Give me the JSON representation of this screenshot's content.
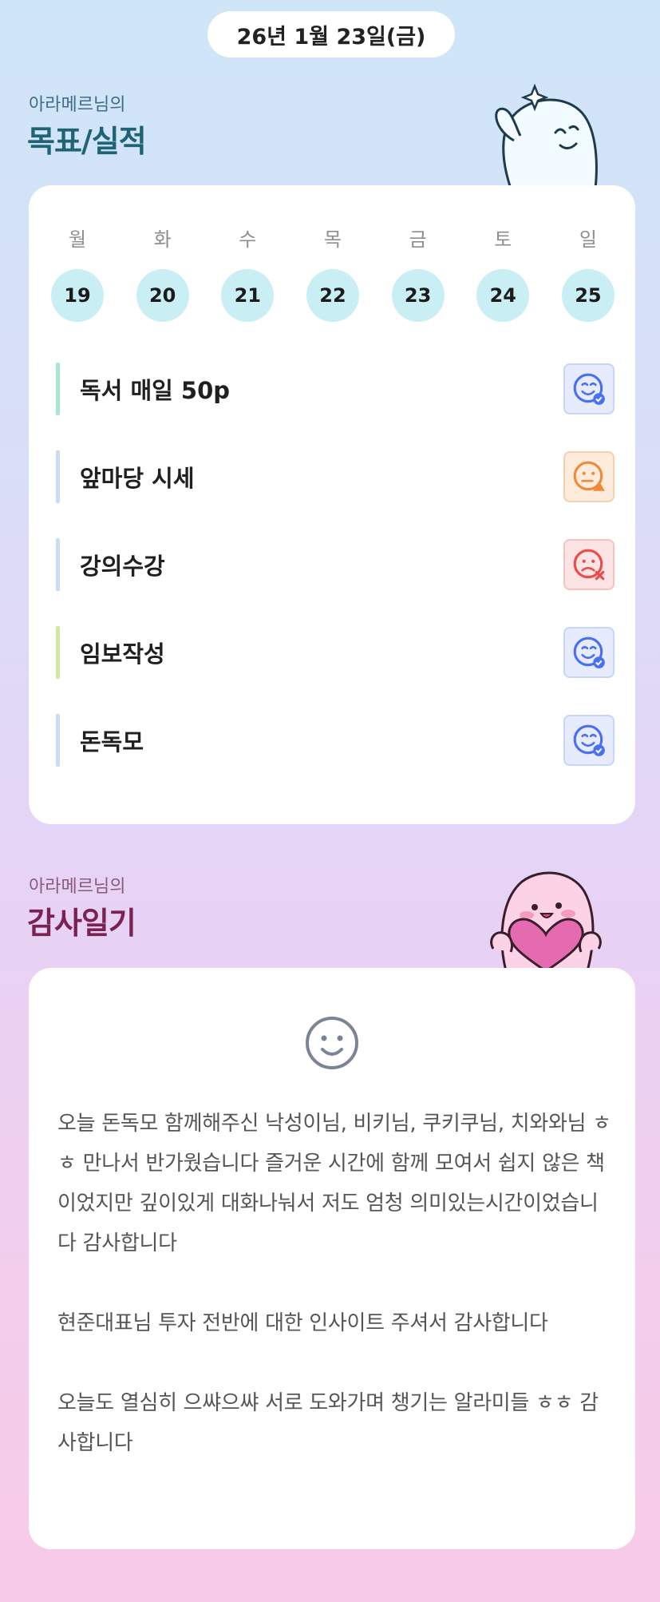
{
  "header": {
    "date": "26년 1월 23일(금)"
  },
  "goals_section": {
    "subtitle": "아라메르님의",
    "title": "목표/실적",
    "weekdays": [
      "월",
      "화",
      "수",
      "목",
      "금",
      "토",
      "일"
    ],
    "dates": [
      "19",
      "20",
      "21",
      "22",
      "23",
      "24",
      "25"
    ],
    "items": [
      {
        "label": "독서 매일 50p",
        "status": "done",
        "bar_color": "#a9e7d5"
      },
      {
        "label": "앞마당 시세",
        "status": "partial",
        "bar_color": "#c9dcf3"
      },
      {
        "label": "강의수강",
        "status": "failed",
        "bar_color": "#c9dcf3"
      },
      {
        "label": "임보작성",
        "status": "done",
        "bar_color": "#cdeaa0"
      },
      {
        "label": "돈독모",
        "status": "done",
        "bar_color": "#c9dcf3"
      }
    ]
  },
  "gratitude_section": {
    "subtitle": "아라메르님의",
    "title": "감사일기",
    "paragraphs": [
      "오늘 돈독모 함께해주신 낙성이님, 비키님, 쿠키쿠님, 치와와님 ㅎㅎ 만나서 반가웠습니다 즐거운 시간에 함께 모여서 쉽지 않은 책이었지만 깊이있게 대화나눠서 저도 엄청 의미있는시간이었습니다 감사합니다",
      "현준대표님 투자 전반에 대한 인사이트 주셔서 감사합니다",
      "오늘도 열심히 으쌰으쌰 서로 도와가며 챙기는 알라미들 ㅎㅎ 감사합니다"
    ]
  },
  "status_colors": {
    "done": {
      "bg": "#e6ecfd",
      "stroke": "#4a6ff2",
      "border": "#c7d4fb"
    },
    "partial": {
      "bg": "#fdebdc",
      "stroke": "#f08a3a",
      "border": "#f8cfac"
    },
    "failed": {
      "bg": "#fde4e4",
      "stroke": "#ea4c4c",
      "border": "#f6c1c1"
    }
  },
  "icons": {
    "done": "smile-check-icon",
    "partial": "neutral-warning-icon",
    "failed": "frown-x-icon",
    "diary": "smile-icon"
  }
}
